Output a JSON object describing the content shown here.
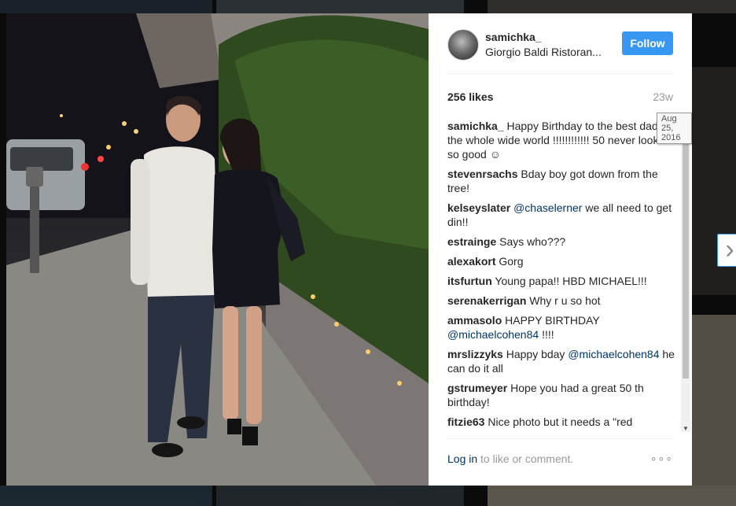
{
  "post": {
    "username": "samichka_",
    "location": "Giorgio Baldi Ristoran...",
    "follow_label": "Follow",
    "likes": "256 likes",
    "age": "23w",
    "date_tooltip": "Aug 25, 2016"
  },
  "comments": [
    {
      "author": "samichka_",
      "text": "Happy Birthday to the best dad in the whole wide world !!!!!!!!!!!! 50 never looked so good ☺"
    },
    {
      "author": "stevenrsachs",
      "text": "Bday boy got down from the tree!"
    },
    {
      "author": "kelseyslater",
      "mention": "@chaselerner",
      "text": "we all need to get din!!"
    },
    {
      "author": "estrainge",
      "text": "Says who???"
    },
    {
      "author": "alexakort",
      "text": "Gorg"
    },
    {
      "author": "itsfurtun",
      "text": "Young papa!! HBD MICHAEL!!!"
    },
    {
      "author": "serenakerrigan",
      "text": "Why r u so hot"
    },
    {
      "author": "ammasolo",
      "text": "HAPPY BIRTHDAY",
      "mention": "@michaelcohen84",
      "text2": "!!!!"
    },
    {
      "author": "mrslizzyks",
      "text": "Happy bday",
      "mention": "@michaelcohen84",
      "text2": "he can do it all"
    },
    {
      "author": "gstrumeyer",
      "text": "Hope you had a great 50 th birthday!"
    },
    {
      "author": "fitzie63",
      "text": "Nice photo but it needs a \"red"
    }
  ],
  "footer": {
    "login_link": "Log in",
    "login_text": "to like or comment.",
    "more_label": "∘∘∘"
  },
  "nav": {
    "next_label": "›"
  },
  "colors": {
    "follow_bg": "#3897f0",
    "link": "#003569",
    "muted": "#999999"
  }
}
